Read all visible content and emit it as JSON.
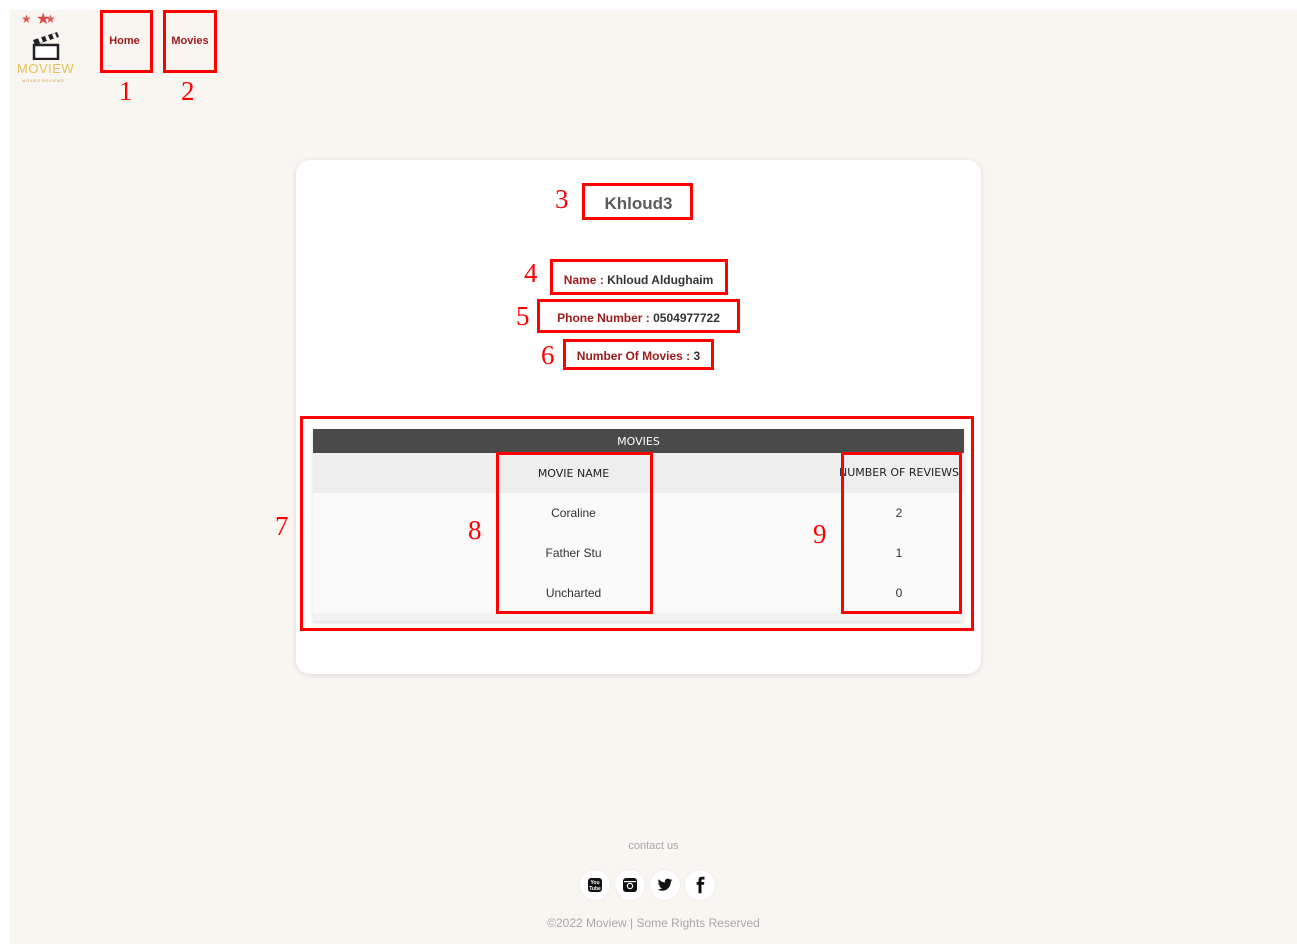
{
  "logo": {
    "word": "MOVIEW",
    "tagline": "MOVIES REVIEWS"
  },
  "nav": {
    "home": "Home",
    "movies": "Movies"
  },
  "profile": {
    "username": "Khloud3",
    "name_label": "Name :",
    "name_value": "Khloud Aldughaim",
    "phone_label": "Phone Number :",
    "phone_value": "0504977722",
    "count_label": "Number Of Movies :",
    "count_value": "3"
  },
  "table": {
    "caption": "MOVIES",
    "headers": [
      "MOVIE NAME",
      "NUMBER OF REVIEWS"
    ],
    "rows": [
      {
        "movie": "Coraline",
        "reviews": "2"
      },
      {
        "movie": "Father Stu",
        "reviews": "1"
      },
      {
        "movie": "Uncharted",
        "reviews": "0"
      }
    ]
  },
  "markers": [
    "1",
    "2",
    "3",
    "4",
    "5",
    "6",
    "7",
    "8",
    "9"
  ],
  "footer": {
    "contact": "contact us",
    "social": [
      "youtube-icon",
      "instagram-icon",
      "twitter-icon",
      "facebook-icon"
    ],
    "copyright": "©2022 Moview | Some Rights Reserved"
  },
  "colors": {
    "background": "#f9f6f2",
    "accent": "#9b1b1b",
    "annotation": "#ff0000",
    "table_header": "#4a4a4a"
  }
}
